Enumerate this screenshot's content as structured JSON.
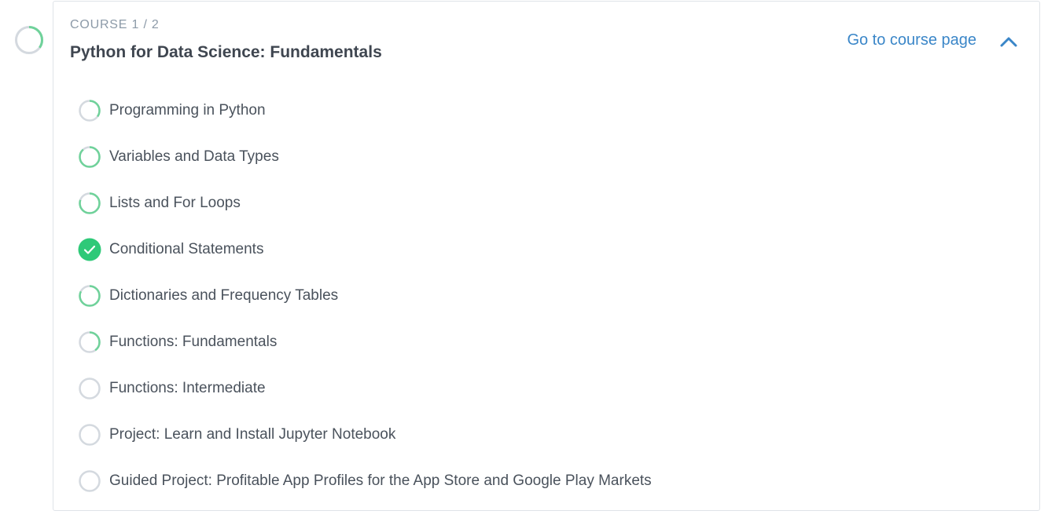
{
  "colors": {
    "progress": "#6fd29a",
    "track": "#d4d9df",
    "complete": "#2ec978",
    "link": "#3a86c8"
  },
  "course": {
    "progress": 0.35,
    "eyebrow": "COURSE 1 / 2",
    "title": "Python for Data Science: Fundamentals",
    "go_link": "Go to course page",
    "collapse_icon": "chevron-up-icon"
  },
  "lessons": [
    {
      "label": "Programming in Python",
      "status": "in-progress",
      "progress": 0.35
    },
    {
      "label": "Variables and Data Types",
      "status": "in-progress",
      "progress": 0.88
    },
    {
      "label": "Lists and For Loops",
      "status": "in-progress",
      "progress": 0.8
    },
    {
      "label": "Conditional Statements",
      "status": "complete",
      "progress": 1.0
    },
    {
      "label": "Dictionaries and Frequency Tables",
      "status": "in-progress",
      "progress": 0.82
    },
    {
      "label": "Functions: Fundamentals",
      "status": "in-progress",
      "progress": 0.4
    },
    {
      "label": "Functions: Intermediate",
      "status": "not-started",
      "progress": 0
    },
    {
      "label": "Project: Learn and Install Jupyter Notebook",
      "status": "not-started",
      "progress": 0
    },
    {
      "label": "Guided Project: Profitable App Profiles for the App Store and Google Play Markets",
      "status": "not-started",
      "progress": 0
    }
  ]
}
